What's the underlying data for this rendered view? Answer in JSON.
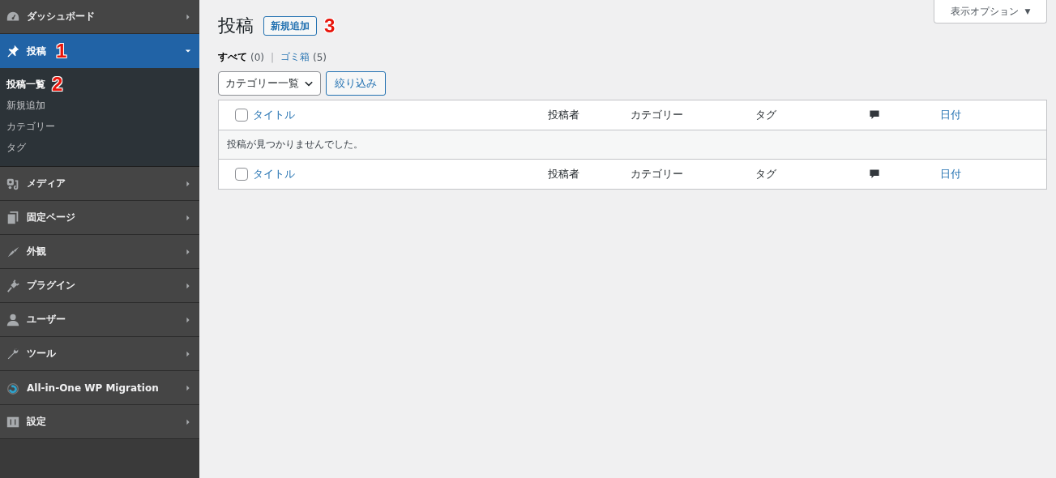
{
  "sidebar": {
    "items": [
      {
        "label": "ダッシュボード",
        "selected": false,
        "expanded": false
      },
      {
        "label": "投稿",
        "selected": true,
        "expanded": true,
        "annotation": "1",
        "children": [
          {
            "label": "投稿一覧",
            "selected": true,
            "annotation": "2"
          },
          {
            "label": "新規追加",
            "selected": false
          },
          {
            "label": "カテゴリー",
            "selected": false
          },
          {
            "label": "タグ",
            "selected": false
          }
        ]
      },
      {
        "label": "メディア",
        "selected": false,
        "expanded": false
      },
      {
        "label": "固定ページ",
        "selected": false,
        "expanded": false
      },
      {
        "label": "外観",
        "selected": false,
        "expanded": false
      },
      {
        "label": "プラグイン",
        "selected": false,
        "expanded": false
      },
      {
        "label": "ユーザー",
        "selected": false,
        "expanded": false
      },
      {
        "label": "ツール",
        "selected": false,
        "expanded": false
      },
      {
        "label": "All-in-One WP Migration",
        "selected": false,
        "expanded": false
      },
      {
        "label": "設定",
        "selected": false,
        "expanded": false
      }
    ]
  },
  "screen_options": {
    "label": "表示オプション",
    "arrow": "▼"
  },
  "page": {
    "title": "投稿",
    "add_new": "新規追加",
    "annotation": "3"
  },
  "views": [
    {
      "label": "すべて",
      "count": "(0)",
      "selected": true
    },
    {
      "label": "ゴミ箱",
      "count": "(5)",
      "selected": false
    }
  ],
  "views_separator": "|",
  "filters": {
    "category_select": "カテゴリー一覧",
    "filter_button": "絞り込み"
  },
  "table": {
    "header_columns": [
      {
        "label": "タイトル",
        "kind": "link"
      },
      {
        "label": "投稿者",
        "kind": "text"
      },
      {
        "label": "カテゴリー",
        "kind": "text"
      },
      {
        "label": "タグ",
        "kind": "text"
      },
      {
        "kind": "comments"
      },
      {
        "label": "日付",
        "kind": "link"
      }
    ],
    "footer_columns": [
      {
        "label": "タイトル",
        "kind": "link"
      },
      {
        "label": "投稿者",
        "kind": "text"
      },
      {
        "label": "カテゴリー",
        "kind": "text"
      },
      {
        "label": "タグ",
        "kind": "text"
      },
      {
        "kind": "comments"
      },
      {
        "label": "日付",
        "kind": "link"
      }
    ],
    "header_checked": false,
    "footer_checked": false,
    "empty_message": "投稿が見つかりませんでした。"
  }
}
